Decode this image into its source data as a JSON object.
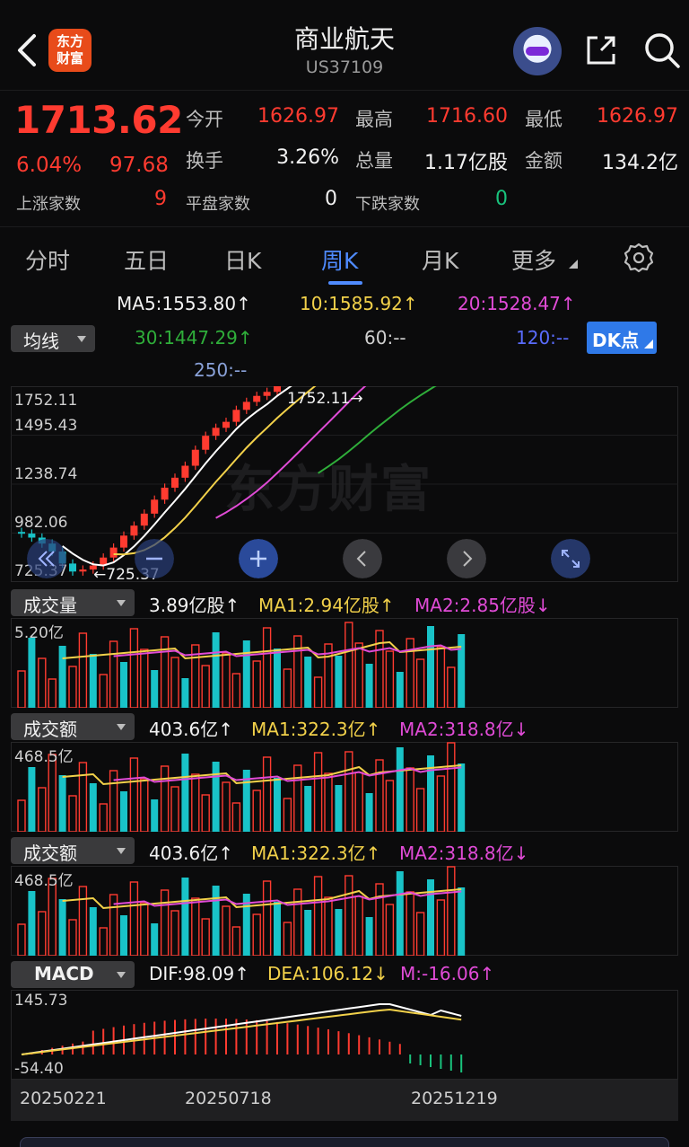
{
  "header": {
    "title": "商业航天",
    "code": "US37109",
    "logo_text_line1": "东方",
    "logo_text_line2": "财富"
  },
  "quote": {
    "price": "1713.62",
    "change_pct": "6.04%",
    "change": "97.68",
    "open_label": "今开",
    "open": "1626.97",
    "high_label": "最高",
    "high": "1716.60",
    "low_label": "最低",
    "low": "1626.97",
    "turnover_label": "换手",
    "turnover": "3.26%",
    "volume_label": "总量",
    "volume": "1.17亿股",
    "amount_label": "金额",
    "amount": "134.2亿",
    "up_label": "上涨家数",
    "up": "9",
    "flat_label": "平盘家数",
    "flat": "0",
    "down_label": "下跌家数",
    "down": "0"
  },
  "tabs": [
    "分时",
    "五日",
    "日K",
    "周K",
    "月K",
    "更多"
  ],
  "active_tab": "周K",
  "ma_legend": {
    "select_label": "均线",
    "ma5": "MA5:1553.80↑",
    "ma10": "10:1585.92↑",
    "ma20": "20:1528.47↑",
    "ma30": "30:1447.29↑",
    "ma60": "60:--",
    "ma120": "120:--",
    "ma250": "250:--",
    "dk_button": "DK点"
  },
  "kline": {
    "y_labels": [
      "1752.11",
      "1495.43",
      "1238.74",
      "982.06",
      "725.37"
    ],
    "max_marker": "1752.11",
    "min_marker": "725.37",
    "watermark": "东方财富"
  },
  "volume_panel": {
    "select_label": "成交量",
    "value": "3.89亿股↑",
    "ma1": "MA1:2.94亿股↑",
    "ma2": "MA2:2.85亿股↓",
    "y_max": "5.20亿"
  },
  "amount_panel_1": {
    "select_label": "成交额",
    "value": "403.6亿↑",
    "ma1": "MA1:322.3亿↑",
    "ma2": "MA2:318.8亿↓",
    "y_max": "468.5亿"
  },
  "amount_panel_2": {
    "select_label": "成交额",
    "value": "403.6亿↑",
    "ma1": "MA1:322.3亿↑",
    "ma2": "MA2:318.8亿↓",
    "y_max": "468.5亿"
  },
  "macd_panel": {
    "select_label": "MACD",
    "dif": "DIF:98.09↑",
    "dea": "DEA:106.12↓",
    "m": "M:-16.06↑",
    "y_max": "145.73",
    "y_min": "-54.40"
  },
  "date_axis": [
    "20250221",
    "20250718",
    "20251219"
  ],
  "colors": {
    "up": "#ff3b30",
    "down": "#19c3c8",
    "ma5": "#ffffff",
    "ma10": "#f2d14a",
    "ma20": "#e04bd6",
    "ma30": "#2fae3a",
    "accent": "#4f8bff"
  }
}
